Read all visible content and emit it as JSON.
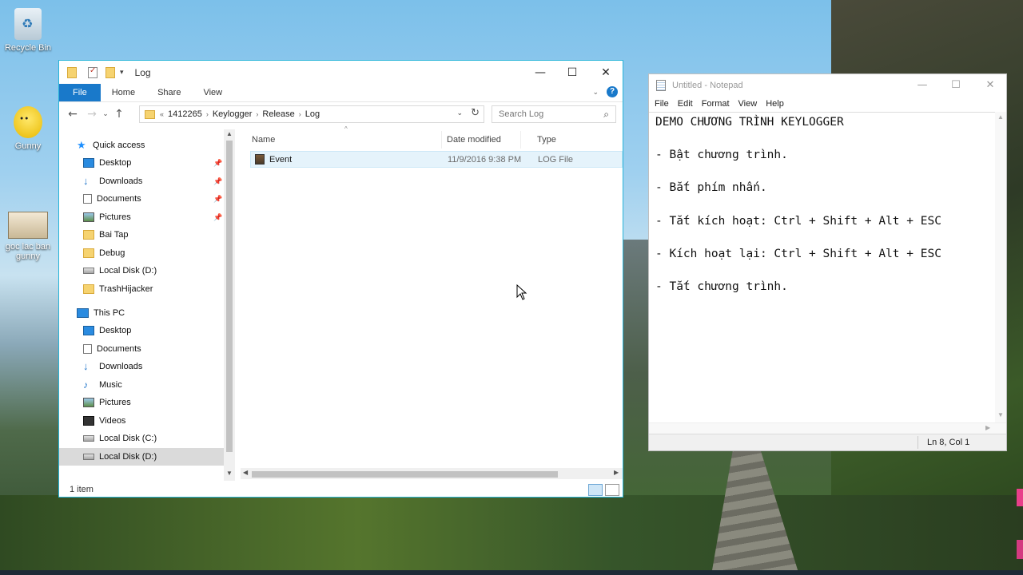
{
  "desktop": {
    "icons": [
      {
        "label": "Recycle Bin"
      },
      {
        "label": "Gunny"
      },
      {
        "label": "goc lac ban gunny"
      }
    ]
  },
  "explorer": {
    "title": "Log",
    "window_buttons": {
      "minimize": "—",
      "maximize": "☐",
      "close": "✕"
    },
    "ribbon_tabs": [
      "File",
      "Home",
      "Share",
      "View"
    ],
    "address": {
      "overflow": "«",
      "crumbs": [
        "1412265",
        "Keylogger",
        "Release",
        "Log"
      ]
    },
    "search_placeholder": "Search Log",
    "sidebar": {
      "quick_access": "Quick access",
      "quick_items": [
        "Desktop",
        "Downloads",
        "Documents",
        "Pictures",
        "Bai Tap",
        "Debug",
        "Local Disk (D:)",
        "TrashHijacker"
      ],
      "this_pc": "This PC",
      "pc_items": [
        "Desktop",
        "Documents",
        "Downloads",
        "Music",
        "Pictures",
        "Videos",
        "Local Disk (C:)",
        "Local Disk (D:)"
      ],
      "selected": "Local Disk (D:)"
    },
    "columns": [
      "Name",
      "Date modified",
      "Type"
    ],
    "files": [
      {
        "name": "Event",
        "date": "11/9/2016 9:38 PM",
        "type": "LOG File"
      }
    ],
    "status": "1 item"
  },
  "notepad": {
    "title": "Untitled - Notepad",
    "menu": [
      "File",
      "Edit",
      "Format",
      "View",
      "Help"
    ],
    "lines": [
      "DEMO CHƯƠNG TRÌNH KEYLOGGER",
      "",
      "- Bật chương trình.",
      "",
      "- Bắt phím nhấn.",
      "",
      "- Tắt kích hoạt: Ctrl + Shift + Alt + ESC",
      "",
      "- Kích hoạt lại: Ctrl + Shift + Alt + ESC",
      "",
      "- Tắt chương trình."
    ],
    "status": "Ln 8, Col 1"
  }
}
